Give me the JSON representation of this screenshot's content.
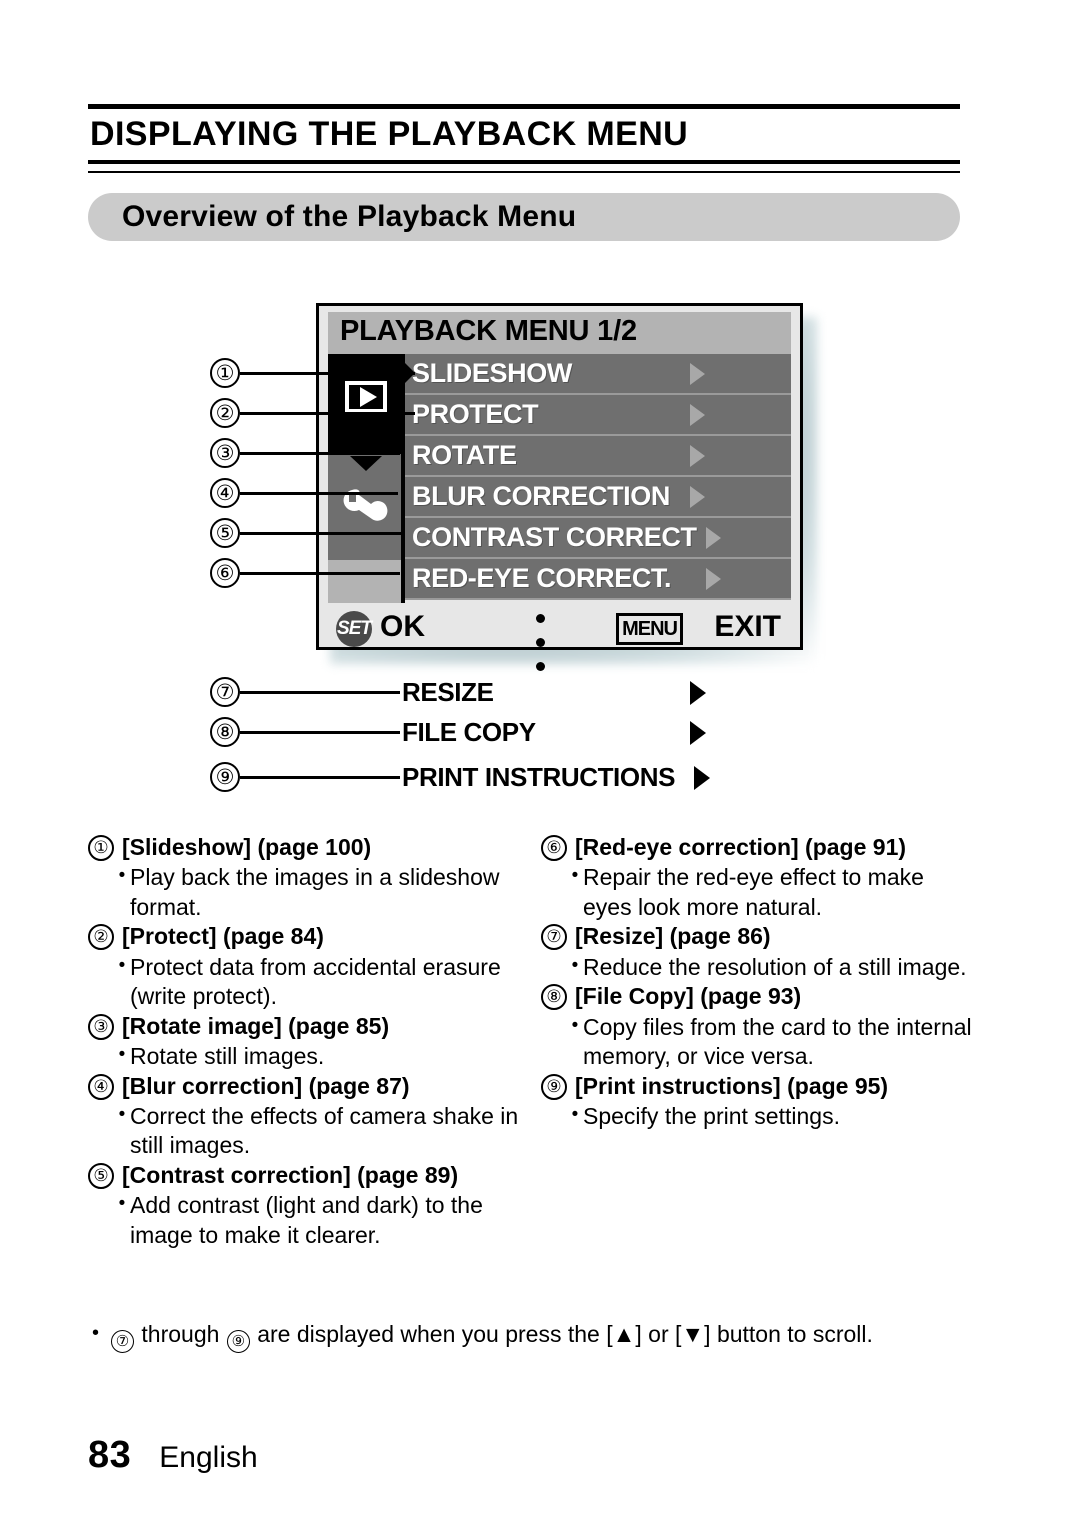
{
  "header": {
    "chapter_title": "DISPLAYING THE PLAYBACK MENU",
    "section_title": "Overview of the Playback Menu"
  },
  "lcd": {
    "title": "PLAYBACK MENU 1/2",
    "rows": [
      {
        "callout": "①",
        "label": "SLIDESHOW"
      },
      {
        "callout": "②",
        "label": "PROTECT"
      },
      {
        "callout": "③",
        "label": "ROTATE"
      },
      {
        "callout": "④",
        "label": "BLUR CORRECTION"
      },
      {
        "callout": "⑤",
        "label": "CONTRAST CORRECT"
      },
      {
        "callout": "⑥",
        "label": "RED-EYE CORRECT."
      }
    ],
    "bottom": {
      "set_badge": "SET",
      "ok_label": "OK",
      "menu_badge": "MENU",
      "exit_label": "EXIT"
    },
    "sidebar_icons": [
      "play-tab-icon",
      "down-arrow-tab-icon",
      "wrench-tab-icon"
    ]
  },
  "scroll_items": [
    {
      "callout": "⑦",
      "label": "RESIZE"
    },
    {
      "callout": "⑧",
      "label": "FILE COPY"
    },
    {
      "callout": "⑨",
      "label": "PRINT INSTRUCTIONS"
    }
  ],
  "descriptions": {
    "left": [
      {
        "num": "①",
        "head": "[Slideshow] (page 100)",
        "bullets": [
          "Play back the images in a slideshow format."
        ]
      },
      {
        "num": "②",
        "head": "[Protect] (page 84)",
        "bullets": [
          "Protect data from accidental erasure (write protect)."
        ]
      },
      {
        "num": "③",
        "head": "[Rotate image] (page 85)",
        "bullets": [
          "Rotate still images."
        ]
      },
      {
        "num": "④",
        "head": "[Blur correction] (page 87)",
        "bullets": [
          "Correct the effects of camera shake in still images."
        ]
      },
      {
        "num": "⑤",
        "head": "[Contrast correction] (page 89)",
        "bullets": [
          "Add contrast (light and dark) to the image to make it clearer."
        ]
      }
    ],
    "right": [
      {
        "num": "⑥",
        "head": "[Red-eye correction] (page 91)",
        "bullets": [
          "Repair the red-eye effect to make eyes look more natural."
        ]
      },
      {
        "num": "⑦",
        "head": "[Resize] (page 86)",
        "bullets": [
          "Reduce the resolution of a still image."
        ]
      },
      {
        "num": "⑧",
        "head": "[File Copy] (page 93)",
        "bullets": [
          "Copy files from the card to the internal memory, or vice versa."
        ]
      },
      {
        "num": "⑨",
        "head": "[Print instructions] (page 95)",
        "bullets": [
          "Specify the print settings."
        ]
      }
    ]
  },
  "footnote": {
    "num_start": "⑦",
    "num_end": "⑨",
    "text_a": "through",
    "text_b": "are displayed when you press the [▲] or [▼] button to scroll."
  },
  "footer": {
    "page_number": "83",
    "language": "English"
  }
}
